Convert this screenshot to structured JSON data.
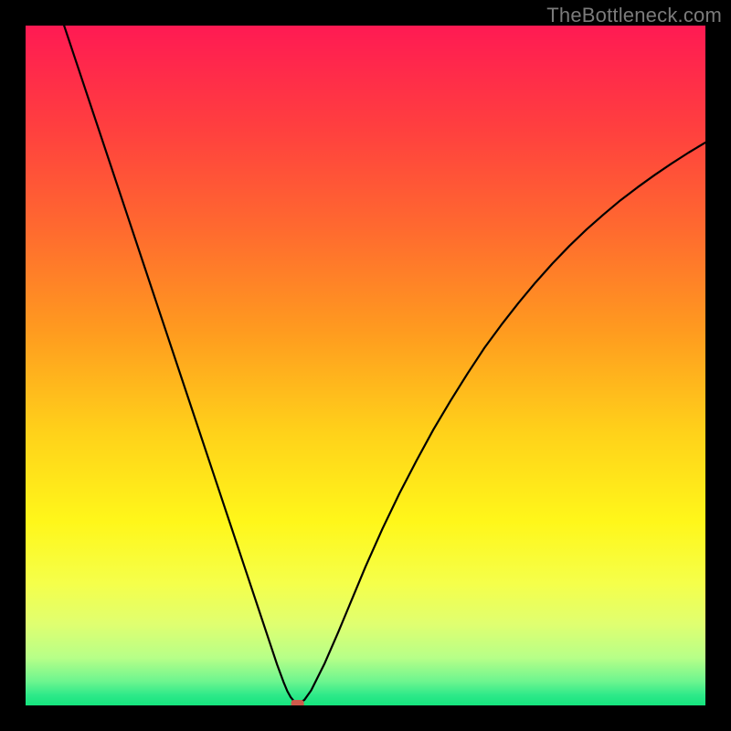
{
  "watermark": "TheBottleneck.com",
  "chart_data": {
    "type": "line",
    "title": "",
    "xlabel": "",
    "ylabel": "",
    "xlim": [
      0,
      100
    ],
    "ylim": [
      0,
      100
    ],
    "grid": false,
    "legend": false,
    "series": [
      {
        "name": "bottleneck-curve",
        "x": [
          0,
          2.5,
          5,
          7.5,
          10,
          12.5,
          15,
          17.5,
          20,
          22.5,
          25,
          27.5,
          30,
          32.5,
          35,
          36,
          37,
          38,
          38.5,
          39,
          39.5,
          40,
          41,
          42,
          44,
          46,
          48,
          50,
          52.5,
          55,
          57.5,
          60,
          62.5,
          65,
          67.5,
          70,
          72.5,
          75,
          77.5,
          80,
          82.5,
          85,
          87.5,
          90,
          92.5,
          95,
          97.5,
          100
        ],
        "y": [
          118,
          110,
          102,
          94.5,
          87,
          79.5,
          72,
          64.5,
          57,
          49.5,
          42,
          34.5,
          27,
          19.5,
          12,
          9,
          6,
          3.3,
          2.1,
          1.2,
          0.6,
          0.25,
          0.8,
          2.2,
          6.2,
          10.8,
          15.6,
          20.4,
          26,
          31.2,
          36,
          40.6,
          44.8,
          48.8,
          52.6,
          56,
          59.2,
          62.2,
          65,
          67.6,
          70,
          72.2,
          74.3,
          76.2,
          78,
          79.7,
          81.3,
          82.8
        ]
      }
    ],
    "marker": {
      "name": "bottleneck-point",
      "x": 40,
      "y": 0.2,
      "color": "#cf5a4b"
    },
    "background": {
      "type": "vertical-gradient",
      "stops": [
        {
          "pos": 0.0,
          "color": "#ff1a53"
        },
        {
          "pos": 0.15,
          "color": "#ff3f3f"
        },
        {
          "pos": 0.3,
          "color": "#ff6a2f"
        },
        {
          "pos": 0.45,
          "color": "#ff9b1f"
        },
        {
          "pos": 0.6,
          "color": "#ffd21a"
        },
        {
          "pos": 0.73,
          "color": "#fff71a"
        },
        {
          "pos": 0.82,
          "color": "#f5ff4a"
        },
        {
          "pos": 0.88,
          "color": "#e0ff70"
        },
        {
          "pos": 0.93,
          "color": "#b7ff88"
        },
        {
          "pos": 0.965,
          "color": "#6cf58f"
        },
        {
          "pos": 0.985,
          "color": "#2de989"
        },
        {
          "pos": 1.0,
          "color": "#15e47e"
        }
      ]
    }
  }
}
